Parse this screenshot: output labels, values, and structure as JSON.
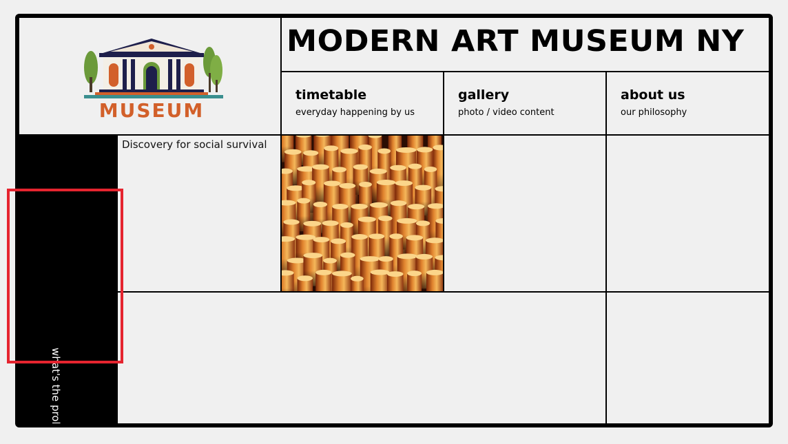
{
  "header": {
    "logo_text": "MUSEUM",
    "title": "MODERN ART MUSEUM NY"
  },
  "nav": [
    {
      "label": "timetable",
      "sub": "everyday happening by us"
    },
    {
      "label": "gallery",
      "sub": "photo / video content"
    },
    {
      "label": "about us",
      "sub": "our philosophy"
    }
  ],
  "sidebar": {
    "vertical_label": "what's the problem"
  },
  "content": {
    "discovery_text": "Discovery for social survival"
  },
  "colors": {
    "highlight": "#e5242f",
    "logo_navy": "#1e1f4b",
    "logo_orange": "#d2602a",
    "logo_green": "#6b9a3a",
    "logo_teal": "#3a8f8f"
  }
}
